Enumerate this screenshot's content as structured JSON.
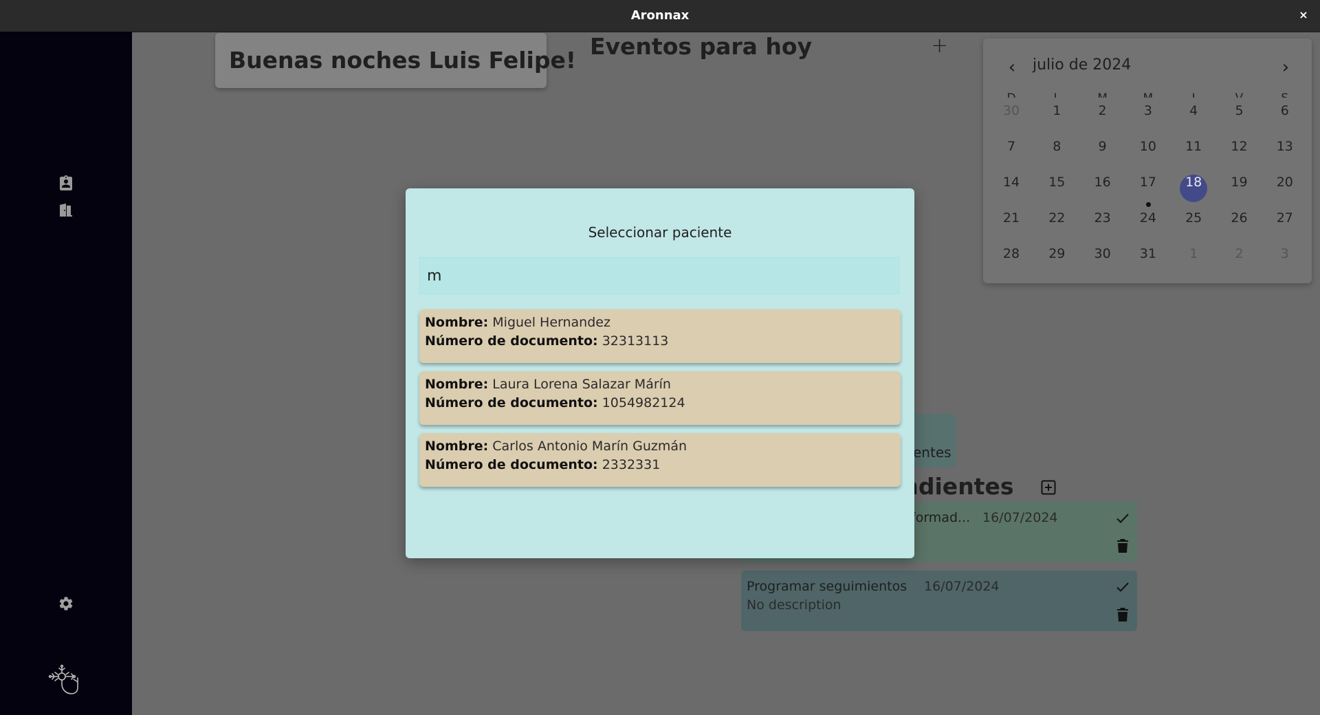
{
  "app": {
    "title": "Aronnax",
    "close_glyph": "×"
  },
  "sidebar": {
    "icons": [
      "clipboard-icon",
      "door-icon",
      "gear-icon",
      "neuron-logo-icon"
    ]
  },
  "greeting": "Buenas noches Luis Felipe!",
  "events": {
    "title": "Eventos para hoy",
    "add_glyph": "+"
  },
  "calendar": {
    "month_label": "julio de 2024",
    "weekdays": [
      "D",
      "L",
      "M",
      "M",
      "J",
      "V",
      "S"
    ],
    "selected_day": "18",
    "event_days": [
      "17"
    ],
    "weeks": [
      [
        "30",
        "1",
        "2",
        "3",
        "4",
        "5",
        "6"
      ],
      [
        "7",
        "8",
        "9",
        "10",
        "11",
        "12",
        "13"
      ],
      [
        "14",
        "15",
        "16",
        "17",
        "18",
        "19",
        "20"
      ],
      [
        "21",
        "22",
        "23",
        "24",
        "25",
        "26",
        "27"
      ],
      [
        "28",
        "29",
        "30",
        "31",
        "1",
        "2",
        "3"
      ]
    ]
  },
  "partial_card_text": "entes",
  "pending": {
    "title": "endientes",
    "tasks": [
      {
        "title": "formad...",
        "date": "16/07/2024",
        "description": "",
        "color": "#5b7468"
      },
      {
        "title": "Programar seguimientos",
        "date": "16/07/2024",
        "description": "No description",
        "color": "#4f6568"
      }
    ]
  },
  "modal": {
    "title": "Seleccionar paciente",
    "search_value": "m",
    "name_label": "Nombre:",
    "doc_label": "Número de documento:",
    "patients": [
      {
        "name": "Miguel Hernandez",
        "document": "32313113"
      },
      {
        "name": "Laura Lorena Salazar Márín",
        "document": "1054982124"
      },
      {
        "name": "Carlos Antonio Marín Guzmán",
        "document": "2332331"
      }
    ]
  },
  "colors": {
    "modal_bg": "#c1e7e7",
    "patient_card": "#dbcdb0",
    "selected_day": "#434a8a",
    "sidebar_bg": "#05020f"
  }
}
